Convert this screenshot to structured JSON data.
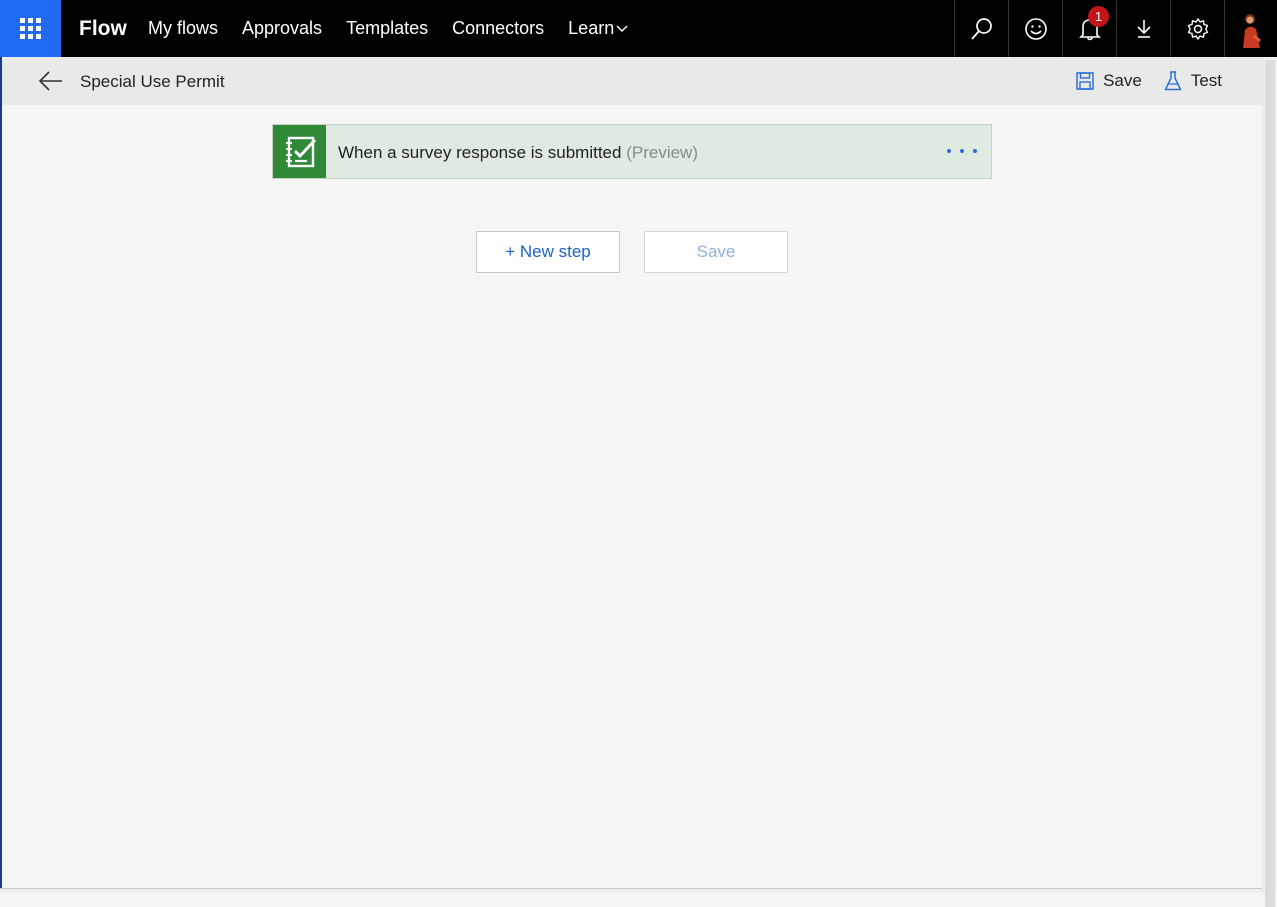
{
  "app": {
    "brand": "Flow",
    "nav": [
      "My flows",
      "Approvals",
      "Templates",
      "Connectors",
      "Learn"
    ],
    "notification_count": "1",
    "icons": [
      "waffle-icon",
      "search-icon",
      "smiley-icon",
      "bell-icon",
      "download-icon",
      "gear-icon",
      "avatar"
    ]
  },
  "subheader": {
    "flow_name": "Special Use Permit",
    "save_label": "Save",
    "test_label": "Test"
  },
  "trigger": {
    "title": "When a survey response is submitted",
    "tag": "(Preview)"
  },
  "buttons": {
    "new_step": "+ New step",
    "save": "Save"
  },
  "colors": {
    "accent": "#1f6bf2",
    "trigger_icon": "#2f8a37",
    "link": "#1d62c4",
    "badge": "#c4141a"
  }
}
